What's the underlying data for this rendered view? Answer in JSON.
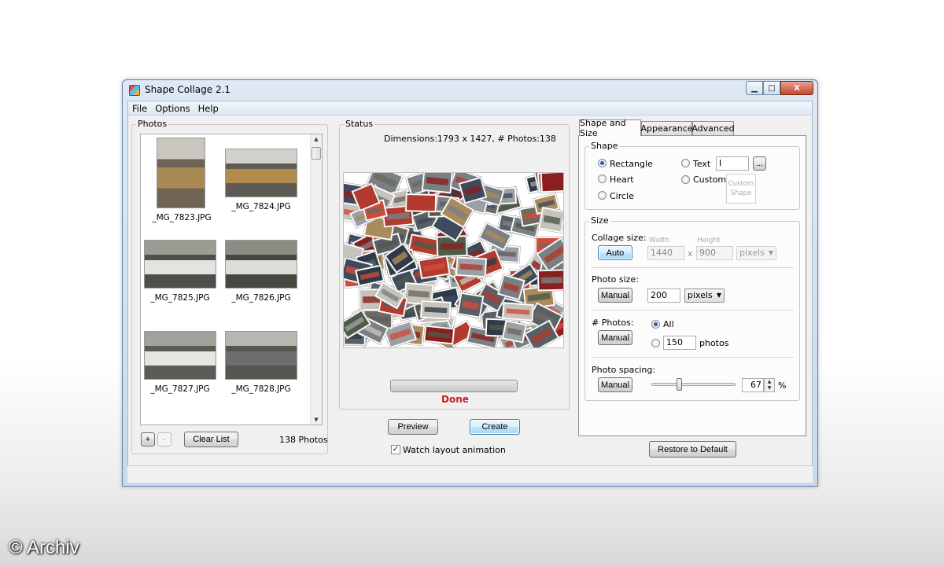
{
  "window": {
    "title": "Shape Collage 2.1",
    "close_glyph": "X",
    "min_glyph": "▁",
    "max_glyph": "□"
  },
  "menu": [
    "File",
    "Options",
    "Help"
  ],
  "photos": {
    "label": "Photos",
    "items": [
      {
        "name": "_MG_7823.JPG",
        "colors": [
          "#6f6356",
          "#a98a52",
          "#c9c6bf"
        ]
      },
      {
        "name": "_MG_7824.JPG",
        "colors": [
          "#5e5a54",
          "#b08b4b",
          "#d3d1cc"
        ]
      },
      {
        "name": "_MG_7825.JPG",
        "colors": [
          "#4d4f4a",
          "#e3e3e0",
          "#9b9d94"
        ]
      },
      {
        "name": "_MG_7826.JPG",
        "colors": [
          "#46483f",
          "#dcdcd8",
          "#8b8c84"
        ]
      },
      {
        "name": "_MG_7827.JPG",
        "colors": [
          "#5a5c57",
          "#e7e5df",
          "#a2a29b"
        ]
      },
      {
        "name": "_MG_7828.JPG",
        "colors": [
          "#555650",
          "#6e6e6e",
          "#b7b6af"
        ]
      }
    ],
    "add_label": "+",
    "remove_label": "-",
    "clear_label": "Clear List",
    "count": "138 Photos"
  },
  "status": {
    "label": "Status",
    "dimensions": "Dimensions:1793 x 1427, # Photos:138",
    "progress": 1.0,
    "done_text": "Done",
    "done_color": "#cc1f1f"
  },
  "actions": {
    "preview": "Preview",
    "create": "Create",
    "watch_label": "Watch layout animation",
    "watch_checked": true
  },
  "tabs": [
    "Shape and Size",
    "Appearance",
    "Advanced"
  ],
  "shape": {
    "label": "Shape",
    "options": [
      "Rectangle",
      "Heart",
      "Circle"
    ],
    "selected": "Rectangle",
    "text_label": "Text",
    "text_value": "I",
    "browse_label": "...",
    "custom_label": "Custom",
    "custom_shape_line1": "Custom",
    "custom_shape_line2": "Shape"
  },
  "size": {
    "label": "Size",
    "collage_size_label": "Collage size:",
    "auto_label": "Auto",
    "width_label": "Width",
    "height_label": "Height",
    "width_value": "1440",
    "height_value": "900",
    "x_label": "x",
    "collage_unit": "pixels",
    "photo_size_label": "Photo size:",
    "photo_size_mode": "Manual",
    "photo_size_value": "200",
    "photo_size_unit": "pixels",
    "photos_count_label": "# Photos:",
    "photos_count_mode": "Manual",
    "all_label": "All",
    "photos_number": "150",
    "photos_unit": "photos",
    "spacing_label": "Photo spacing:",
    "spacing_mode": "Manual",
    "spacing_value": "67",
    "spacing_fraction": 0.33,
    "spacing_unit": "%"
  },
  "restore_label": "Restore to Default",
  "watermark": "© Archiv"
}
